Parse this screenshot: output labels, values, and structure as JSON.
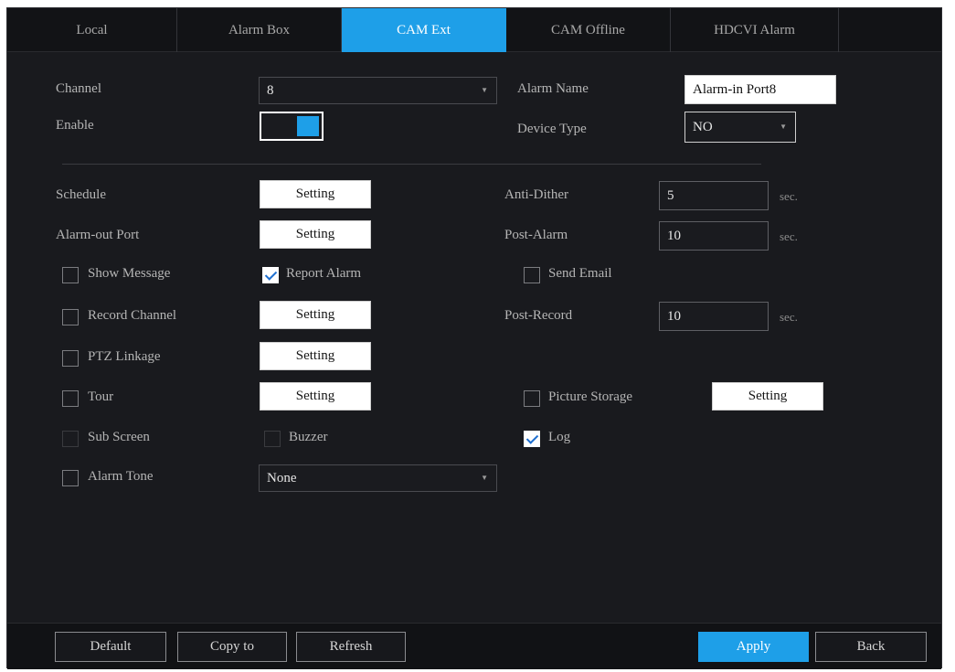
{
  "tabs": [
    {
      "label": "Local"
    },
    {
      "label": "Alarm Box"
    },
    {
      "label": "CAM Ext"
    },
    {
      "label": "CAM Offline"
    },
    {
      "label": "HDCVI Alarm"
    }
  ],
  "form": {
    "channel": {
      "label": "Channel",
      "value": "8"
    },
    "enable": {
      "label": "Enable",
      "on": true
    },
    "alarm_name": {
      "label": "Alarm Name",
      "value": "Alarm-in Port8"
    },
    "device_type": {
      "label": "Device Type",
      "value": "NO"
    },
    "schedule": {
      "label": "Schedule",
      "button": "Setting"
    },
    "alarm_out_port": {
      "label": "Alarm-out Port",
      "button": "Setting"
    },
    "anti_dither": {
      "label": "Anti-Dither",
      "value": "5",
      "unit": "sec."
    },
    "post_alarm": {
      "label": "Post-Alarm",
      "value": "10",
      "unit": "sec."
    },
    "show_message": {
      "label": "Show Message",
      "checked": false
    },
    "report_alarm": {
      "label": "Report Alarm",
      "checked": true
    },
    "send_email": {
      "label": "Send Email",
      "checked": false
    },
    "record_channel": {
      "label": "Record Channel",
      "checked": false,
      "button": "Setting"
    },
    "post_record": {
      "label": "Post-Record",
      "value": "10",
      "unit": "sec."
    },
    "ptz_linkage": {
      "label": "PTZ Linkage",
      "checked": false,
      "button": "Setting"
    },
    "tour": {
      "label": "Tour",
      "checked": false,
      "button": "Setting"
    },
    "picture_storage": {
      "label": "Picture Storage",
      "checked": false,
      "button": "Setting"
    },
    "sub_screen": {
      "label": "Sub Screen",
      "checked": false
    },
    "buzzer": {
      "label": "Buzzer",
      "checked": false
    },
    "log": {
      "label": "Log",
      "checked": true
    },
    "alarm_tone": {
      "label": "Alarm Tone",
      "checked": false,
      "value": "None"
    }
  },
  "footer": {
    "default": "Default",
    "copy_to": "Copy to",
    "refresh": "Refresh",
    "apply": "Apply",
    "back": "Back"
  },
  "colors": {
    "accent": "#1e9fe8",
    "panel": "#191a1e"
  }
}
